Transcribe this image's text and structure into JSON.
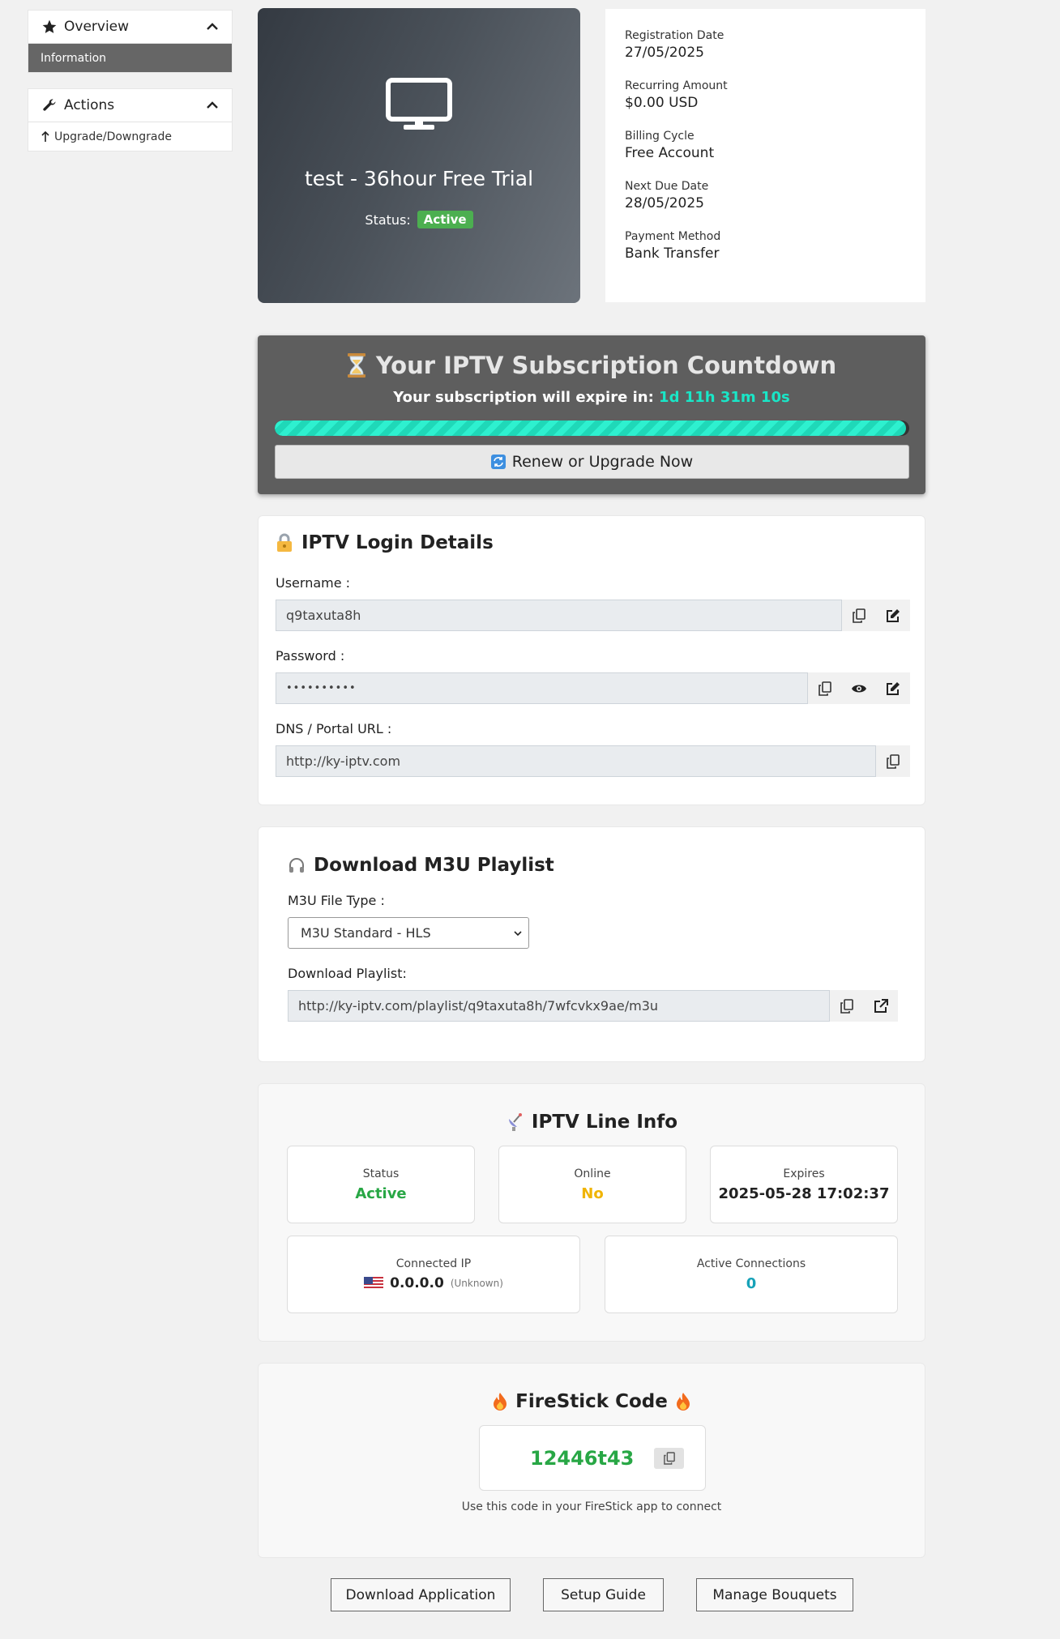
{
  "sidebar": {
    "overview_label": "Overview",
    "information_label": "Information",
    "actions_label": "Actions",
    "upgrade_label": "Upgrade/Downgrade"
  },
  "product": {
    "title": "test - 36hour Free Trial",
    "status_label": "Status:",
    "status_value": "Active"
  },
  "billing": {
    "registration_label": "Registration Date",
    "registration_value": "27/05/2025",
    "recurring_label": "Recurring Amount",
    "recurring_value": "$0.00 USD",
    "cycle_label": "Billing Cycle",
    "cycle_value": "Free Account",
    "due_label": "Next Due Date",
    "due_value": "28/05/2025",
    "payment_label": "Payment Method",
    "payment_value": "Bank Transfer"
  },
  "countdown": {
    "title": "Your IPTV Subscription Countdown",
    "subtitle": "Your subscription will expire in:",
    "time_left": "1d 11h 31m 10s",
    "progress_percent": 99.5,
    "renew_label": "Renew or Upgrade Now"
  },
  "login": {
    "title": "IPTV Login Details",
    "username_label": "Username :",
    "username_value": "q9taxuta8h",
    "password_label": "Password :",
    "password_value": "••••••••••",
    "dns_label": "DNS / Portal URL :",
    "dns_value": "http://ky-iptv.com"
  },
  "playlist": {
    "title": "Download M3U Playlist",
    "filetype_label": "M3U File Type :",
    "filetype_selected": "M3U Standard - HLS",
    "download_label": "Download Playlist:",
    "download_url": "http://ky-iptv.com/playlist/q9taxuta8h/7wfcvkx9ae/m3u"
  },
  "line_info": {
    "title": "IPTV Line Info",
    "status_label": "Status",
    "status_value": "Active",
    "online_label": "Online",
    "online_value": "No",
    "expires_label": "Expires",
    "expires_value": "2025-05-28 17:02:37",
    "ip_label": "Connected IP",
    "ip_value": "0.0.0.0",
    "ip_location": "(Unknown)",
    "connections_label": "Active Connections",
    "connections_value": "0"
  },
  "firestick": {
    "title": "FireStick Code",
    "code": "12446t43",
    "hint": "Use this code in your FireStick app to connect"
  },
  "buttons": {
    "download_app": "Download Application",
    "setup_guide": "Setup Guide",
    "manage_bouquets": "Manage Bouquets"
  },
  "colors": {
    "accent_teal": "#19e6c7",
    "status_green": "#28a745",
    "online_amber": "#f0b400",
    "connections_cyan": "#17a2b8"
  },
  "icons": [
    "star-icon",
    "chevron-up-icon",
    "wrench-icon",
    "arrow-up-icon",
    "monitor-icon",
    "hourglass-icon",
    "renew-icon",
    "lock-icon",
    "copy-icon",
    "edit-icon",
    "eye-icon",
    "headphones-icon",
    "external-link-icon",
    "satellite-icon",
    "us-flag-icon",
    "fire-icon"
  ]
}
